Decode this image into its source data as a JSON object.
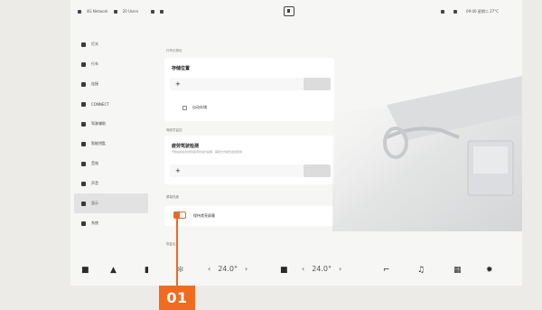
{
  "status_bar": {
    "left_items": [
      "4G Network",
      "20 Users"
    ],
    "right_time": "09:00 星期二 27°C"
  },
  "sidebar": {
    "items": [
      {
        "label": "灯光"
      },
      {
        "label": "行车"
      },
      {
        "label": "连接"
      },
      {
        "label": "CONNECT"
      },
      {
        "label": "驾驶辅助"
      },
      {
        "label": "智能钥匙"
      },
      {
        "label": "音效"
      },
      {
        "label": "声音"
      },
      {
        "label": "显示"
      },
      {
        "label": "系统"
      }
    ],
    "active_index": 8
  },
  "sections": {
    "s1_title": "行车记录仪",
    "card1": {
      "title": "存储位置",
      "value": "+",
      "check_label": "自动存储"
    },
    "s2_title": "驾驶员监控",
    "card2": {
      "title": "疲劳驾驶检测",
      "subtitle": "开启后将在检测到疲劳时进行提醒，需配合驾驶员监控使用",
      "value": "+"
    },
    "s3_title": "屏幕亮度",
    "card3": {
      "toggle_label": "保持常亮屏幕",
      "toggle_on": true
    },
    "s4_title": "恢复出厂"
  },
  "bottom_bar": {
    "left_temp": "24.0°",
    "right_temp": "24.0°"
  },
  "callout": {
    "label": "01",
    "color": "#f06a1f"
  }
}
